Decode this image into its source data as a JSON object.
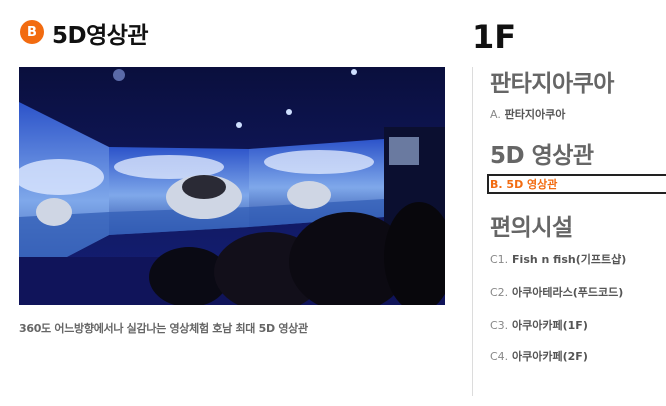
{
  "header": {
    "badge": "B",
    "title": "5D영상관",
    "floor": "1F"
  },
  "main": {
    "caption": "360도 어느방향에서나 실감나는 영상체험 호남 최대 5D 영상관"
  },
  "menu": {
    "groups": [
      {
        "title": "판타지아쿠아",
        "items": [
          {
            "prefix": "A.",
            "label": "판타지아쿠아"
          }
        ]
      },
      {
        "title": "5D 영상관",
        "items": [
          {
            "prefix": "B.",
            "label": "5D 영상관",
            "active": true
          }
        ]
      },
      {
        "title": "편의시설",
        "items": [
          {
            "prefix": "C1.",
            "label": "Fish n fish(기프트샵)"
          },
          {
            "prefix": "C2.",
            "label": "아쿠아테라스(푸드코드)"
          },
          {
            "prefix": "C3.",
            "label": "아쿠아카페(1F)"
          },
          {
            "prefix": "C4.",
            "label": "아쿠아카페(2F)"
          }
        ]
      }
    ]
  },
  "colors": {
    "accent": "#f26b10",
    "heading": "#666666"
  }
}
